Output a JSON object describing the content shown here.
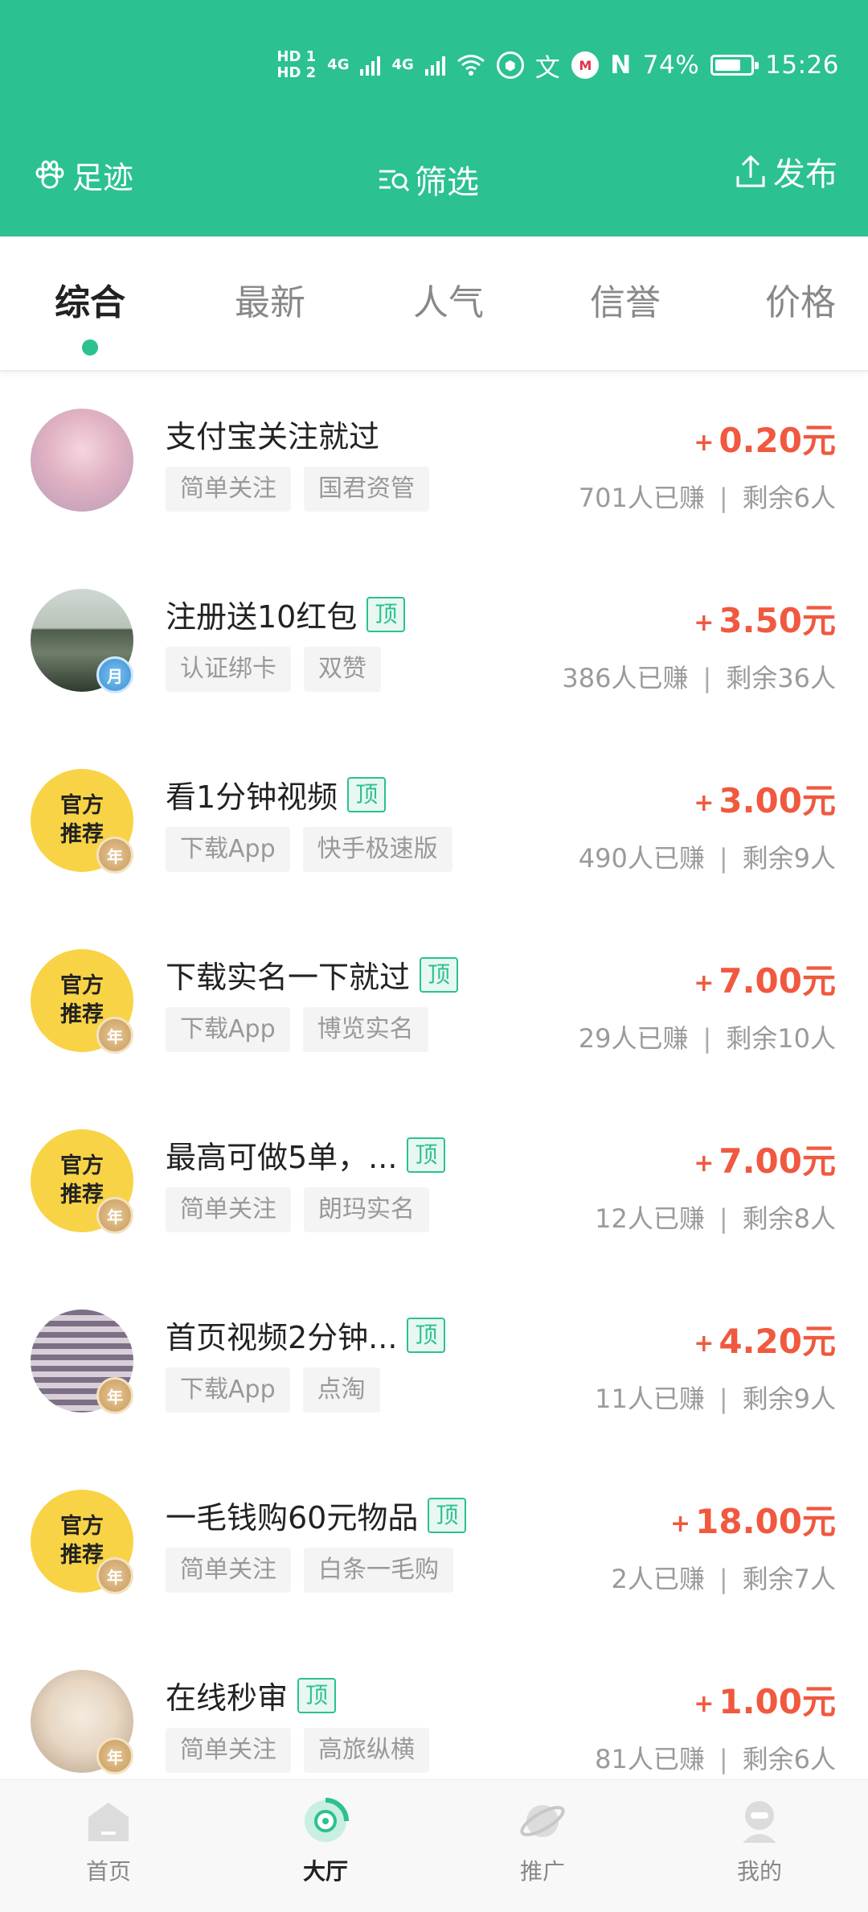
{
  "statusbar": {
    "hd1": "HD 1",
    "hd2": "HD 2",
    "net1": "4G",
    "net2": "4G",
    "wen": "文",
    "battery_text": "74%",
    "battery_level": 0.74,
    "time": "15:26"
  },
  "navbar": {
    "left_label": "足迹",
    "center_label": "筛选",
    "right_label": "发布"
  },
  "tabs": [
    {
      "label": "综合",
      "active": true
    },
    {
      "label": "最新",
      "active": false
    },
    {
      "label": "人气",
      "active": false
    },
    {
      "label": "信誉",
      "active": false
    },
    {
      "label": "价格",
      "active": false
    }
  ],
  "avatar_official_text": [
    "官方",
    "推荐"
  ],
  "badge_labels": {
    "year": "年",
    "month": "月"
  },
  "top_tag_label": "顶",
  "stats_sep": "|",
  "tasks": [
    {
      "title": "支付宝关注就过",
      "top": false,
      "tags": [
        "简单关注",
        "国君资管"
      ],
      "plus": "+",
      "price": "0.20元",
      "earned": "701人已赚",
      "remaining": "剩余6人",
      "avatar": "photo1",
      "badge": "none"
    },
    {
      "title": "注册送10红包",
      "top": true,
      "tags": [
        "认证绑卡",
        "双赞"
      ],
      "plus": "+",
      "price": "3.50元",
      "earned": "386人已赚",
      "remaining": "剩余36人",
      "avatar": "photo2",
      "badge": "month"
    },
    {
      "title": "看1分钟视频",
      "top": true,
      "tags": [
        "下载App",
        "快手极速版"
      ],
      "plus": "+",
      "price": "3.00元",
      "earned": "490人已赚",
      "remaining": "剩余9人",
      "avatar": "official",
      "badge": "year"
    },
    {
      "title": "下载实名一下就过",
      "top": true,
      "tags": [
        "下载App",
        "博览实名"
      ],
      "plus": "+",
      "price": "7.00元",
      "earned": "29人已赚",
      "remaining": "剩余10人",
      "avatar": "official",
      "badge": "year"
    },
    {
      "title": "最高可做5单，...",
      "top": true,
      "tags": [
        "简单关注",
        "朗玛实名"
      ],
      "plus": "+",
      "price": "7.00元",
      "earned": "12人已赚",
      "remaining": "剩余8人",
      "avatar": "official",
      "badge": "year"
    },
    {
      "title": "首页视频2分钟...",
      "top": true,
      "tags": [
        "下载App",
        "点淘"
      ],
      "plus": "+",
      "price": "4.20元",
      "earned": "11人已赚",
      "remaining": "剩余9人",
      "avatar": "photo3",
      "badge": "year"
    },
    {
      "title": "一毛钱购60元物品",
      "top": true,
      "tags": [
        "简单关注",
        "白条一毛购"
      ],
      "plus": "+",
      "price": "18.00元",
      "earned": "2人已赚",
      "remaining": "剩余7人",
      "avatar": "official",
      "badge": "year"
    },
    {
      "title": "在线秒审",
      "top": true,
      "tags": [
        "简单关注",
        "高旅纵横"
      ],
      "plus": "+",
      "price": "1.00元",
      "earned": "81人已赚",
      "remaining": "剩余6人",
      "avatar": "photo4",
      "badge": "year"
    }
  ],
  "bottomnav": [
    {
      "label": "首页",
      "icon": "home-icon",
      "active": false
    },
    {
      "label": "大厅",
      "icon": "hall-icon",
      "active": true
    },
    {
      "label": "推广",
      "icon": "planet-icon",
      "active": false
    },
    {
      "label": "我的",
      "icon": "profile-icon",
      "active": false
    }
  ],
  "colors": {
    "brand_green": "#2bc191",
    "price_red": "#f0593f",
    "official_yellow": "#f8d346"
  }
}
